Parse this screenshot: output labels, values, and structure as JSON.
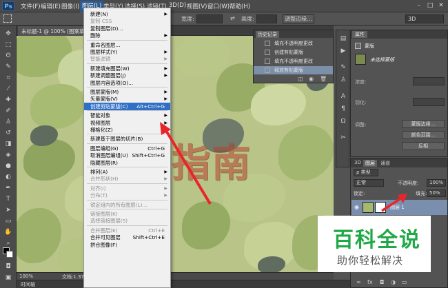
{
  "menubar": {
    "logo": "Ps",
    "items": [
      "文件(F)",
      "编辑(E)",
      "图像(I)",
      "图层(L)",
      "类型(Y)",
      "选择(S)",
      "滤镜(T)",
      "3D(D)",
      "视图(V)",
      "窗口(W)",
      "帮助(H)"
    ],
    "active_index": 3
  },
  "options": {
    "width_label": "宽度:",
    "height_label": "高度:",
    "edge_button": "调整边缘...",
    "workspace": "3D"
  },
  "document": {
    "tab": "未标题-1 @ 100% (图案填充...",
    "zoom": "100%",
    "doc_info": "文档:1.37M/...",
    "timeline": "时间轴"
  },
  "watermark_text": "指南",
  "layer_menu": {
    "items": [
      {
        "label": "新建(N)",
        "submenu": true
      },
      {
        "label": "复制 CSS",
        "disabled": true
      },
      {
        "label": "复制图层(D)..."
      },
      {
        "label": "删除",
        "submenu": true
      },
      {
        "sep": true
      },
      {
        "label": "重命名图层..."
      },
      {
        "label": "图层样式(Y)",
        "submenu": true
      },
      {
        "label": "智能滤镜",
        "disabled": true,
        "submenu": true
      },
      {
        "sep": true
      },
      {
        "label": "新建填充图层(W)",
        "submenu": true
      },
      {
        "label": "新建调整图层(J)",
        "submenu": true
      },
      {
        "label": "图层内容选项(O)..."
      },
      {
        "sep": true
      },
      {
        "label": "图层蒙版(M)",
        "submenu": true
      },
      {
        "label": "矢量蒙版(V)",
        "submenu": true
      },
      {
        "label": "创建剪贴蒙版(C)",
        "shortcut": "Alt+Ctrl+G",
        "highlight": true
      },
      {
        "sep": true
      },
      {
        "label": "智能对象",
        "submenu": true
      },
      {
        "label": "视频图层",
        "submenu": true
      },
      {
        "label": "栅格化(Z)",
        "submenu": true
      },
      {
        "sep": true
      },
      {
        "label": "新建基于图层的切片(B)"
      },
      {
        "sep": true
      },
      {
        "label": "图层编组(G)",
        "shortcut": "Ctrl+G"
      },
      {
        "label": "取消图层编组(U)",
        "shortcut": "Shift+Ctrl+G"
      },
      {
        "label": "隐藏图层(R)"
      },
      {
        "sep": true
      },
      {
        "label": "排列(A)",
        "submenu": true
      },
      {
        "label": "合并形状(H)",
        "disabled": true,
        "submenu": true
      },
      {
        "sep": true
      },
      {
        "label": "对齐(I)",
        "disabled": true,
        "submenu": true
      },
      {
        "label": "分布(T)",
        "disabled": true,
        "submenu": true
      },
      {
        "sep": true
      },
      {
        "label": "锁定组内的所有图层(L)...",
        "disabled": true
      },
      {
        "sep": true
      },
      {
        "label": "链接图层(K)",
        "disabled": true
      },
      {
        "label": "选择链接图层(S)",
        "disabled": true
      },
      {
        "sep": true
      },
      {
        "label": "合并图层(E)",
        "shortcut": "Ctrl+E",
        "disabled": true
      },
      {
        "label": "合并可见图层",
        "shortcut": "Shift+Ctrl+E"
      },
      {
        "label": "拼合图像(F)"
      }
    ]
  },
  "history": {
    "title": "历史记录",
    "items": [
      "填充不透明度更改",
      "创建剪贴蒙版",
      "填充不透明度更改",
      "释放剪贴蒙版"
    ],
    "selected_index": 3
  },
  "properties": {
    "tab": "属性",
    "mask_label": "蒙版",
    "layer_mask": "未选择蒙版",
    "density_label": "浓度:",
    "feather_label": "羽化:",
    "refine_label": "调整:",
    "btn_edge": "蒙版边缘...",
    "btn_color": "颜色范围...",
    "btn_invert": "反相"
  },
  "layers": {
    "tabs": [
      "3D",
      "图层",
      "通道"
    ],
    "active_tab": 1,
    "kind": "ρ 类型",
    "blend_mode": "正常",
    "opacity_label": "不透明度:",
    "opacity": "100%",
    "lock_label": "锁定:",
    "fill_label": "填充:",
    "fill": "50%",
    "layer_name": "图层 1"
  },
  "brand": {
    "title": "百科全说",
    "subtitle": "助你轻松解决"
  },
  "colors": {
    "menu_highlight": "#2f6fc5",
    "arrow": "#e8262a",
    "brand_green": "#1fa846",
    "watermark": "#b7422c"
  }
}
